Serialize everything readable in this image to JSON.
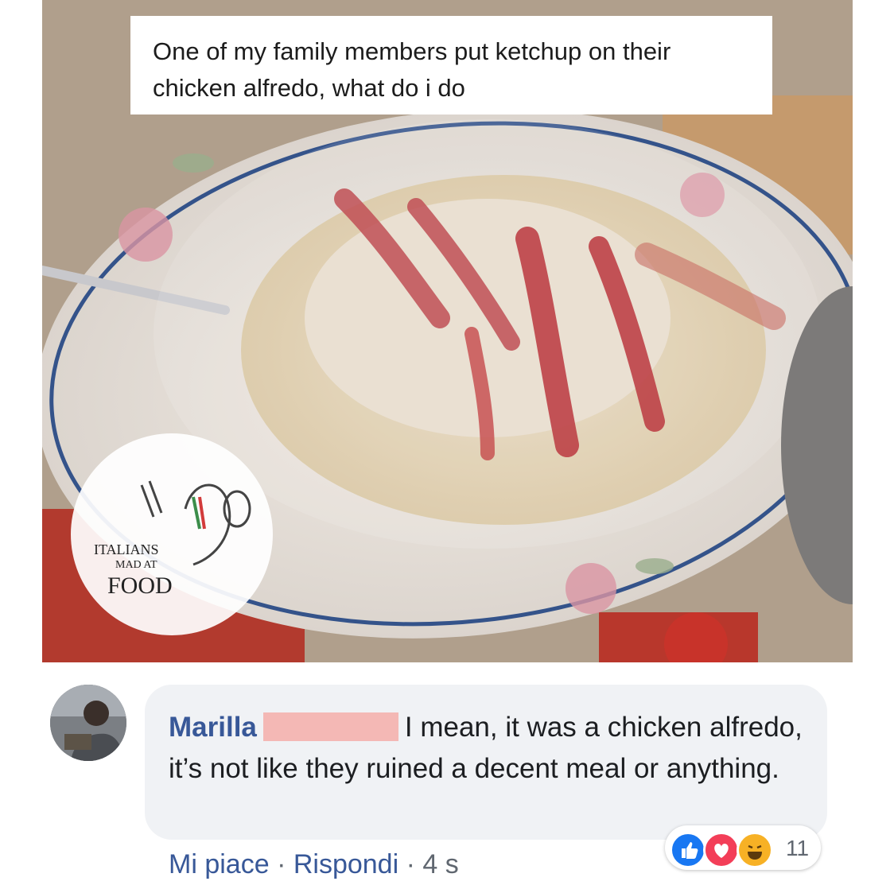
{
  "post": {
    "caption": "One of my family members put ketchup on their chicken alfredo, what do i do",
    "watermark": {
      "line1": "ITALIANS",
      "line2": "MAD AT",
      "line3": "FOOD"
    }
  },
  "comment": {
    "author": "Marilla",
    "text": "I mean, it was a chicken alfredo, it’s not like they ruined a decent meal or anything.",
    "actions": {
      "like": "Mi piace",
      "separator": "·",
      "reply": "Rispondi",
      "time": "4 s"
    },
    "reactions": {
      "icons": [
        "like-icon",
        "love-icon",
        "haha-icon"
      ],
      "count": "11"
    }
  },
  "colors": {
    "link": "#385898",
    "bubble": "#f0f2f5",
    "like": "#1877f2",
    "love": "#f33e58",
    "haha": "#f7b125"
  }
}
